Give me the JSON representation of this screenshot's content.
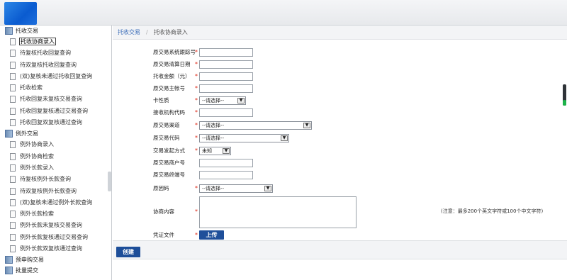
{
  "sidebar": {
    "groups": [
      {
        "label": "托收交易",
        "items": [
          "托收协商录入",
          "待复核托收回复查询",
          "待双复核托收回复查询",
          "(双)复核未通过托收回复查询",
          "托收检索",
          "托收回复未复核交易查询",
          "托收回复复核通过交易查询",
          "托收回复双复核通过查询"
        ]
      },
      {
        "label": "例外交易",
        "items": [
          "例外协商录入",
          "例外协商检索",
          "例外长款录入",
          "待复核例外长款查询",
          "待双复核例外长款查询",
          "(双)复核未通过例外长款查询",
          "例外长款检索",
          "例外长款未复核交易查询",
          "例外长款复核通过交易查询",
          "例外长款双复核通过查询"
        ]
      },
      {
        "label": "预申购交易",
        "items": []
      },
      {
        "label": "批量提交",
        "items": []
      }
    ]
  },
  "breadcrumb": {
    "root": "托收交易",
    "separator": "/",
    "current": "托收协商录入"
  },
  "form": {
    "fields": {
      "orig_trace_no": "原交易系统跟踪号",
      "orig_settle_date": "原交易清算日期",
      "collect_amount": "托收金额（元）",
      "orig_main_account": "原交易主帐号",
      "card_type": "卡性质",
      "recv_org_code": "接收机构代码",
      "orig_channel": "原交易渠道",
      "orig_code": "原交易代码",
      "initiator": "交易发起方式",
      "orig_merchant_no": "原交易商户号",
      "orig_terminal_no": "原交易终端号",
      "reason": "原因码",
      "content": "协商内容",
      "attachment": "凭证文件"
    },
    "required_mark": "*",
    "select_placeholder": "--请选择--",
    "initiator_value": "未知",
    "note": "(注意：最多200个英文字符或100个中文字符)",
    "upload_label": "上传",
    "submit_label": "创建"
  }
}
